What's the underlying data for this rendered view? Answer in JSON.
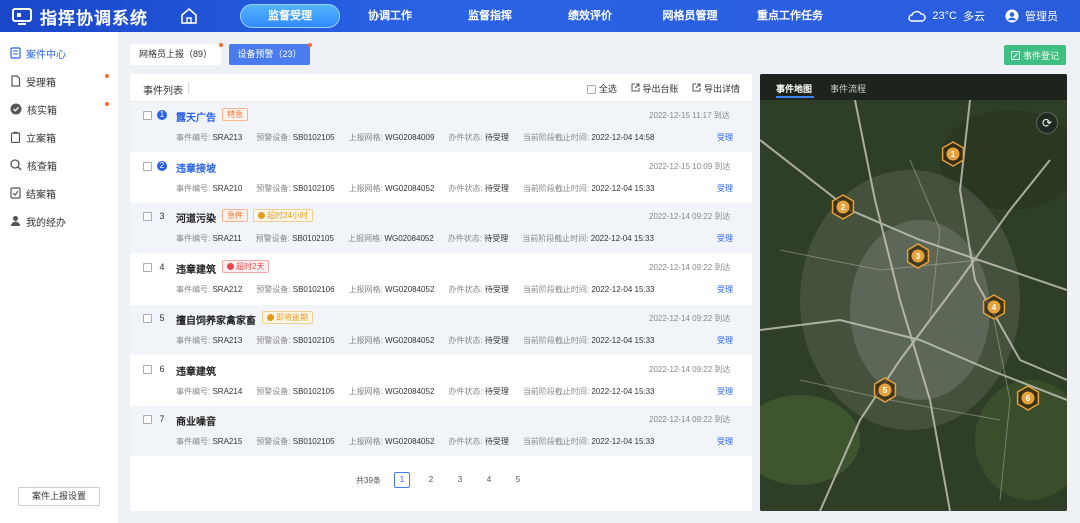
{
  "app": {
    "title": "指挥协调系统"
  },
  "nav": {
    "items": [
      "监督受理",
      "协调工作",
      "监督指挥",
      "绩效评价",
      "网格员管理",
      "重点工作任务"
    ],
    "active": 0
  },
  "weather": {
    "temp": "23°C",
    "desc": "多云"
  },
  "user": {
    "name": "管理员"
  },
  "sidebar": {
    "items": [
      "案件中心",
      "受理箱",
      "核实箱",
      "立案箱",
      "核查箱",
      "结案箱",
      "我的经办"
    ],
    "button": "案件上报设置"
  },
  "tabs": [
    {
      "label": "网格员上报（89）"
    },
    {
      "label": "设备预警（23）"
    }
  ],
  "register_button": "事件登记",
  "list": {
    "title": "事件列表",
    "select_all": "全选",
    "export_ledger": "导出台账",
    "export_detail": "导出详情",
    "labels": {
      "code": "事件编号:",
      "device": "预警设备:",
      "grid": "上报网格:",
      "status": "办件状态:",
      "deadline": "当前阶段截止时间:"
    },
    "action": "受理",
    "rows": [
      {
        "num": "1",
        "title": "露天广告",
        "badges": [
          {
            "text": "特急",
            "type": "urgent"
          }
        ],
        "time": "2022-12-15  11:17  到达",
        "code": "SRA213",
        "device": "SB0102105",
        "grid": "WG02084009",
        "status": "待受理",
        "deadline": "2022-12-04 14:58"
      },
      {
        "num": "2",
        "title": "违章接坡",
        "badges": [],
        "time": "2022-12-15  10:09  到达",
        "code": "SRA210",
        "device": "SB0102105",
        "grid": "WG02084052",
        "status": "待受理",
        "deadline": "2022-12-04 15:33"
      },
      {
        "num": "3",
        "title": "河道污染",
        "badges": [
          {
            "text": "急件",
            "type": "urgent"
          },
          {
            "text": "超时24小时",
            "type": "orange"
          }
        ],
        "time": "2022-12-14  09:22  到达",
        "code": "SRA211",
        "device": "SB0102105",
        "grid": "WG02084052",
        "status": "待受理",
        "deadline": "2022-12-04 15:33"
      },
      {
        "num": "4",
        "title": "违章建筑",
        "badges": [
          {
            "text": "超时2天",
            "type": "red"
          }
        ],
        "time": "2022-12-14  09:22  到达",
        "code": "SRA212",
        "device": "SB0102106",
        "grid": "WG02084052",
        "status": "待受理",
        "deadline": "2022-12-04 15:33"
      },
      {
        "num": "5",
        "title": "擅自饲养家禽家畜",
        "badges": [
          {
            "text": "即将逾期",
            "type": "orange"
          }
        ],
        "time": "2022-12-14  09:22  到达",
        "code": "SRA213",
        "device": "SB0102105",
        "grid": "WG02084052",
        "status": "待受理",
        "deadline": "2022-12-04 15:33"
      },
      {
        "num": "6",
        "title": "违章建筑",
        "badges": [],
        "time": "2022-12-14  09:22  到达",
        "code": "SRA214",
        "device": "SB0102105",
        "grid": "WG02084052",
        "status": "待受理",
        "deadline": "2022-12-04 15:33"
      },
      {
        "num": "7",
        "title": "商业噪音",
        "badges": [],
        "time": "2022-12-14  09:22  到达",
        "code": "SRA215",
        "device": "SB0102105",
        "grid": "WG02084052",
        "status": "待受理",
        "deadline": "2022-12-04 15:33"
      }
    ]
  },
  "pager": {
    "total": "共39条",
    "pages": [
      "1",
      "2",
      "3",
      "4",
      "5"
    ],
    "current": "1"
  },
  "map": {
    "tabs": [
      "事件地图",
      "事件流程"
    ],
    "markers": [
      "1",
      "2",
      "3",
      "4",
      "5",
      "6"
    ]
  },
  "colors": {
    "primary": "#2a63e6",
    "success": "#3fbf82",
    "urgent": "#f56c2d",
    "marker": "#e6a23c"
  }
}
